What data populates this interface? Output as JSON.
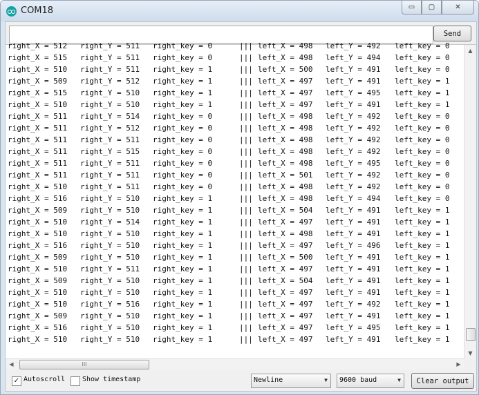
{
  "window": {
    "title": "COM18",
    "min_glyph": "▭",
    "max_glyph": "▢",
    "close_glyph": "✕"
  },
  "toolbar": {
    "send_label": "Send",
    "input_value": ""
  },
  "serial_lines": [
    {
      "rx": "right_X = 512",
      "ry": "right_Y = 511",
      "rk": "right_key = 0",
      "sep": "|||",
      "lx": "left_X = 498",
      "ly": "left_Y = 492",
      "lk": "left_key = 0"
    },
    {
      "rx": "right_X = 515",
      "ry": "right_Y = 511",
      "rk": "right_key = 0",
      "sep": "|||",
      "lx": "left_X = 498",
      "ly": "left_Y = 494",
      "lk": "left_key = 0"
    },
    {
      "rx": "right_X = 510",
      "ry": "right_Y = 511",
      "rk": "right_key = 1",
      "sep": "|||",
      "lx": "left_X = 500",
      "ly": "left_Y = 491",
      "lk": "left_key = 0"
    },
    {
      "rx": "right_X = 509",
      "ry": "right_Y = 512",
      "rk": "right_key = 1",
      "sep": "|||",
      "lx": "left_X = 497",
      "ly": "left_Y = 491",
      "lk": "left_key = 1"
    },
    {
      "rx": "right_X = 515",
      "ry": "right_Y = 510",
      "rk": "right_key = 1",
      "sep": "|||",
      "lx": "left_X = 497",
      "ly": "left_Y = 495",
      "lk": "left_key = 1"
    },
    {
      "rx": "right_X = 510",
      "ry": "right_Y = 510",
      "rk": "right_key = 1",
      "sep": "|||",
      "lx": "left_X = 497",
      "ly": "left_Y = 491",
      "lk": "left_key = 1"
    },
    {
      "rx": "right_X = 511",
      "ry": "right_Y = 514",
      "rk": "right_key = 0",
      "sep": "|||",
      "lx": "left_X = 498",
      "ly": "left_Y = 492",
      "lk": "left_key = 0"
    },
    {
      "rx": "right_X = 511",
      "ry": "right_Y = 512",
      "rk": "right_key = 0",
      "sep": "|||",
      "lx": "left_X = 498",
      "ly": "left_Y = 492",
      "lk": "left_key = 0"
    },
    {
      "rx": "right_X = 511",
      "ry": "right_Y = 511",
      "rk": "right_key = 0",
      "sep": "|||",
      "lx": "left_X = 498",
      "ly": "left_Y = 492",
      "lk": "left_key = 0"
    },
    {
      "rx": "right_X = 511",
      "ry": "right_Y = 515",
      "rk": "right_key = 0",
      "sep": "|||",
      "lx": "left_X = 498",
      "ly": "left_Y = 492",
      "lk": "left_key = 0"
    },
    {
      "rx": "right_X = 511",
      "ry": "right_Y = 511",
      "rk": "right_key = 0",
      "sep": "|||",
      "lx": "left_X = 498",
      "ly": "left_Y = 495",
      "lk": "left_key = 0"
    },
    {
      "rx": "right_X = 511",
      "ry": "right_Y = 511",
      "rk": "right_key = 0",
      "sep": "|||",
      "lx": "left_X = 501",
      "ly": "left_Y = 492",
      "lk": "left_key = 0"
    },
    {
      "rx": "right_X = 510",
      "ry": "right_Y = 511",
      "rk": "right_key = 0",
      "sep": "|||",
      "lx": "left_X = 498",
      "ly": "left_Y = 492",
      "lk": "left_key = 0"
    },
    {
      "rx": "right_X = 516",
      "ry": "right_Y = 510",
      "rk": "right_key = 1",
      "sep": "|||",
      "lx": "left_X = 498",
      "ly": "left_Y = 494",
      "lk": "left_key = 0"
    },
    {
      "rx": "right_X = 509",
      "ry": "right_Y = 510",
      "rk": "right_key = 1",
      "sep": "|||",
      "lx": "left_X = 504",
      "ly": "left_Y = 491",
      "lk": "left_key = 1"
    },
    {
      "rx": "right_X = 510",
      "ry": "right_Y = 514",
      "rk": "right_key = 1",
      "sep": "|||",
      "lx": "left_X = 497",
      "ly": "left_Y = 491",
      "lk": "left_key = 1"
    },
    {
      "rx": "right_X = 510",
      "ry": "right_Y = 510",
      "rk": "right_key = 1",
      "sep": "|||",
      "lx": "left_X = 498",
      "ly": "left_Y = 491",
      "lk": "left_key = 1"
    },
    {
      "rx": "right_X = 516",
      "ry": "right_Y = 510",
      "rk": "right_key = 1",
      "sep": "|||",
      "lx": "left_X = 497",
      "ly": "left_Y = 496",
      "lk": "left_key = 1"
    },
    {
      "rx": "right_X = 509",
      "ry": "right_Y = 510",
      "rk": "right_key = 1",
      "sep": "|||",
      "lx": "left_X = 500",
      "ly": "left_Y = 491",
      "lk": "left_key = 1"
    },
    {
      "rx": "right_X = 510",
      "ry": "right_Y = 511",
      "rk": "right_key = 1",
      "sep": "|||",
      "lx": "left_X = 497",
      "ly": "left_Y = 491",
      "lk": "left_key = 1"
    },
    {
      "rx": "right_X = 509",
      "ry": "right_Y = 510",
      "rk": "right_key = 1",
      "sep": "|||",
      "lx": "left_X = 504",
      "ly": "left_Y = 491",
      "lk": "left_key = 1"
    },
    {
      "rx": "right_X = 510",
      "ry": "right_Y = 510",
      "rk": "right_key = 1",
      "sep": "|||",
      "lx": "left_X = 497",
      "ly": "left_Y = 491",
      "lk": "left_key = 1"
    },
    {
      "rx": "right_X = 510",
      "ry": "right_Y = 516",
      "rk": "right_key = 1",
      "sep": "|||",
      "lx": "left_X = 497",
      "ly": "left_Y = 492",
      "lk": "left_key = 1"
    },
    {
      "rx": "right_X = 509",
      "ry": "right_Y = 510",
      "rk": "right_key = 1",
      "sep": "|||",
      "lx": "left_X = 497",
      "ly": "left_Y = 491",
      "lk": "left_key = 1"
    },
    {
      "rx": "right_X = 516",
      "ry": "right_Y = 510",
      "rk": "right_key = 1",
      "sep": "|||",
      "lx": "left_X = 497",
      "ly": "left_Y = 495",
      "lk": "left_key = 1"
    },
    {
      "rx": "right_X = 510",
      "ry": "right_Y = 510",
      "rk": "right_key = 1",
      "sep": "|||",
      "lx": "left_X = 497",
      "ly": "left_Y = 491",
      "lk": "left_key = 1"
    }
  ],
  "scroll": {
    "up_glyph": "▲",
    "down_glyph": "▼",
    "left_glyph": "◀",
    "right_glyph": "▶",
    "h_thumb_grip": "III"
  },
  "bottom": {
    "autoscroll_label": "Autoscroll",
    "autoscroll_checked": "✓",
    "timestamp_label": "Show timestamp",
    "line_ending": "Newline",
    "baud": "9600 baud",
    "dropdown_glyph": "▼",
    "clear_label": "Clear output"
  }
}
